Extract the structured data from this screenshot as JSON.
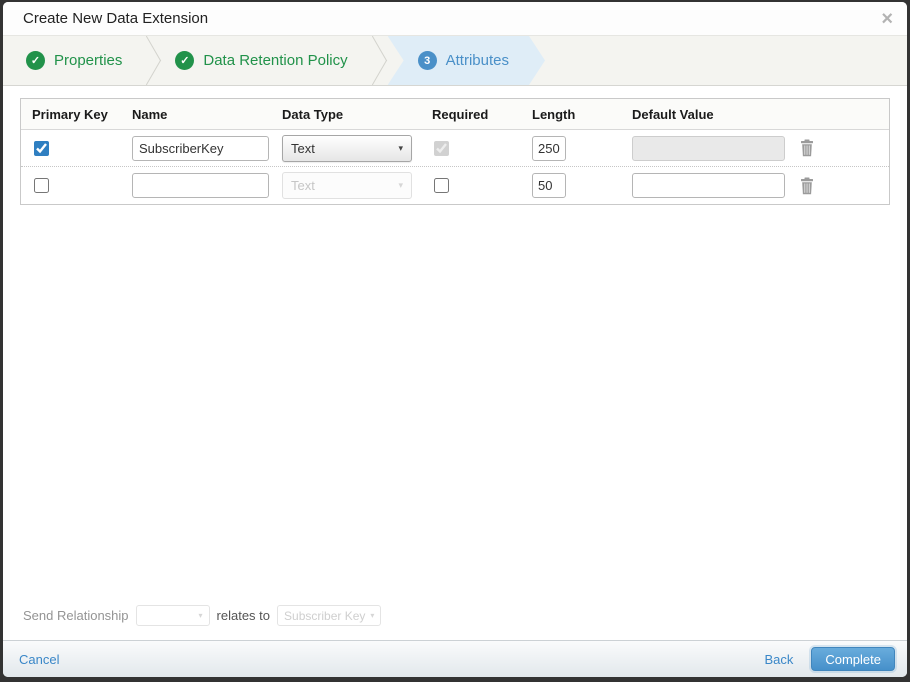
{
  "modal": {
    "title": "Create New Data Extension"
  },
  "icons": {
    "close": "×",
    "check": "✓",
    "caret": "▾"
  },
  "wizard": {
    "steps": [
      {
        "label": "Properties",
        "status": "completed"
      },
      {
        "label": "Data Retention Policy",
        "status": "completed"
      },
      {
        "label": "Attributes",
        "status": "active",
        "number": "3"
      }
    ]
  },
  "attributes_table": {
    "headers": [
      "Primary Key",
      "Name",
      "Data Type",
      "Required",
      "Length",
      "Default Value"
    ],
    "rows": [
      {
        "primary_key_checked": true,
        "name": "SubscriberKey",
        "data_type": "Text",
        "data_type_disabled": false,
        "required_checked": true,
        "required_disabled": true,
        "length": "250",
        "default_value": "",
        "default_value_disabled": true
      },
      {
        "primary_key_checked": false,
        "name": "",
        "data_type": "Text",
        "data_type_disabled": true,
        "required_checked": false,
        "required_disabled": false,
        "length": "50",
        "default_value": "",
        "default_value_disabled": false
      }
    ]
  },
  "send_relationship": {
    "label": "Send Relationship",
    "source_value": "",
    "relates_to_label": "relates to",
    "target_value": "Subscriber Key"
  },
  "footer": {
    "cancel_label": "Cancel",
    "back_label": "Back",
    "complete_label": "Complete"
  },
  "colors": {
    "step_completed_green": "#21924a",
    "step_active_blue": "#4a90c8",
    "link_blue": "#3a87c8",
    "complete_button_blue": "#4690ca"
  }
}
